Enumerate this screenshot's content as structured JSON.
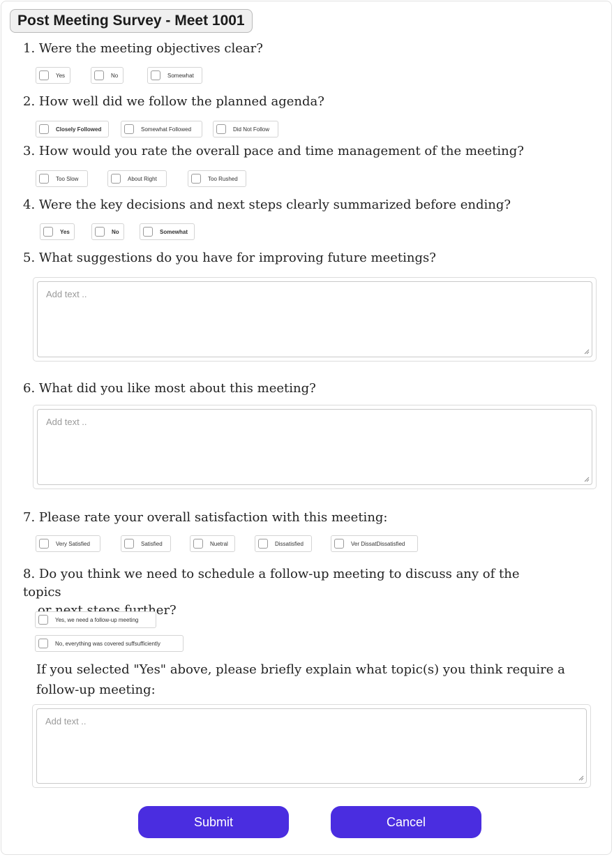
{
  "title": "Post Meeting Survey - Meet 1001",
  "questions": [
    {
      "num": "1.",
      "text": "Were the meeting objectives clear?",
      "options": [
        "Yes",
        "No",
        "Somewhat"
      ]
    },
    {
      "num": "2.",
      "text": "How well did we follow the planned agenda?",
      "options": [
        "Closely Followed",
        "Somewhat Followed",
        "Did Not Follow"
      ]
    },
    {
      "num": "3.",
      "text": "How would you rate the overall pace and time management of the meeting?",
      "options": [
        "Too Slow",
        "About Right",
        "Too Rushed"
      ]
    },
    {
      "num": "4.",
      "text": "Were the key decisions and next steps clearly summarized before ending?",
      "options": [
        "Yes",
        "No",
        "Somewhat"
      ]
    },
    {
      "num": "5.",
      "text": "What suggestions do you have for improving future meetings?",
      "placeholder": "Add text .."
    },
    {
      "num": "6.",
      "text": "What did you like most about this meeting?",
      "placeholder": "Add text .."
    },
    {
      "num": "7.",
      "text": "Please rate your overall satisfaction with this meeting:",
      "options": [
        "Very Satisfied",
        "Satisfied",
        "Nuetral",
        "Dissatisfied",
        "Ver DissatDissatisfied"
      ]
    },
    {
      "num": "8.",
      "text_line1": "Do you think we need to schedule a follow-up meeting to discuss any of the topics",
      "text_line2": "or next steps further?",
      "options": [
        "Yes, we need a follow-up meeting",
        "No, everything was covered suffsufficiently"
      ],
      "followup_line1": "If you selected \"Yes\" above, please briefly explain what topic(s) you think require a",
      "followup_line2": "follow-up meeting:",
      "placeholder": "Add text .."
    }
  ],
  "actions": {
    "submit": "Submit",
    "cancel": "Cancel"
  },
  "colors": {
    "button": "#4a2de0",
    "button_text": "#ffffff"
  }
}
